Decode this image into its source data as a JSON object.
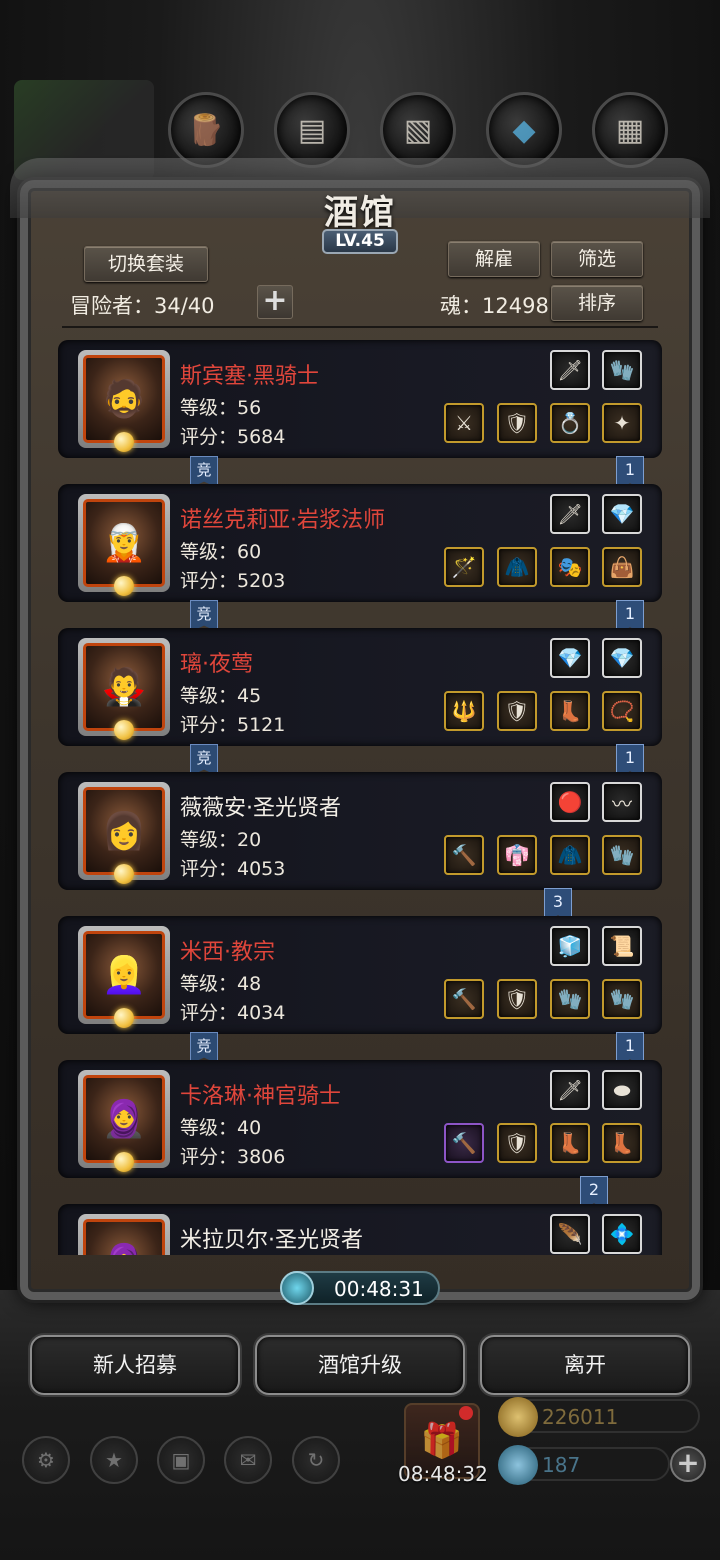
{
  "window": {
    "title": "酒馆",
    "level": "LV.45"
  },
  "toolbar": {
    "switch_outfit": "切换套装",
    "dismiss": "解雇",
    "filter": "筛选",
    "sort": "排序"
  },
  "stats": {
    "adventurers": "冒险者：34/40",
    "soul": "魂：12498"
  },
  "heroes": [
    {
      "name": "斯宾塞·黑骑士",
      "name_color": "red",
      "level": "等级：56",
      "score": "评分：5684",
      "tag_left": "竞",
      "tag_right": "1"
    },
    {
      "name": "诺丝克莉亚·岩浆法师",
      "name_color": "red",
      "level": "等级：60",
      "score": "评分：5203",
      "tag_left": "竞",
      "tag_right": "1"
    },
    {
      "name": "璃·夜莺",
      "name_color": "red",
      "level": "等级：45",
      "score": "评分：5121",
      "tag_left": "竞",
      "tag_right": "1"
    },
    {
      "name": "薇薇安·圣光贤者",
      "name_color": "white",
      "level": "等级：20",
      "score": "评分：4053",
      "tag_left": "",
      "tag_right": "3"
    },
    {
      "name": "米西·教宗",
      "name_color": "red",
      "level": "等级：48",
      "score": "评分：4034",
      "tag_left": "竞",
      "tag_right": "1"
    },
    {
      "name": "卡洛琳·神官骑士",
      "name_color": "red",
      "level": "等级：40",
      "score": "评分：3806",
      "tag_left": "",
      "tag_right": "2"
    },
    {
      "name": "米拉贝尔·圣光贤者",
      "name_color": "white",
      "level": "",
      "score": "",
      "tag_left": "",
      "tag_right": ""
    }
  ],
  "timer": "00:48:31",
  "actions": {
    "recruit": "新人招募",
    "upgrade": "酒馆升级",
    "leave": "离开"
  },
  "gift_timer": "08:48:32",
  "resources": {
    "gold": "226011",
    "gems": "187"
  },
  "colors": {
    "name_red": "#e0463b",
    "gold_border": "#c29a2c",
    "frame": "#5b5b5b"
  },
  "icons": [
    "sword-icon",
    "armor-icon",
    "ring-icon",
    "amulet-icon",
    "gem-icon",
    "gauntlet-icon",
    "gift-icon",
    "settings-icon",
    "mail-icon"
  ]
}
